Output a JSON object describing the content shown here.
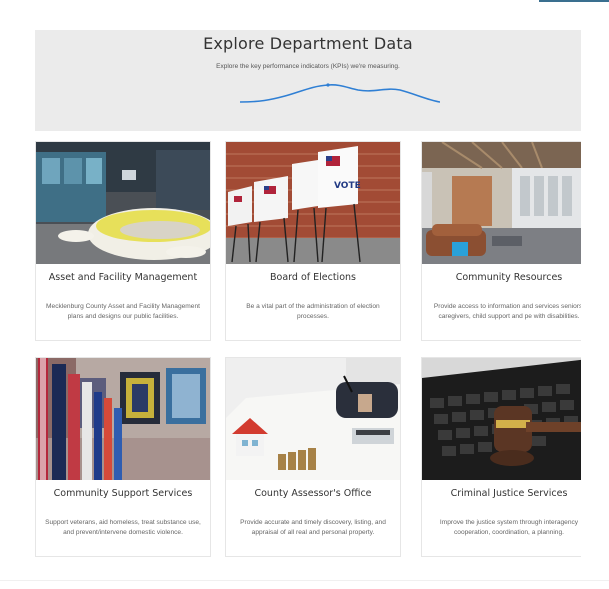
{
  "header": {
    "title": "Explore Department Data",
    "subtitle": "Explore the key performance indicators (KPIs) we're measuring."
  },
  "colors": {
    "hero_bg": "#ebebeb",
    "wave": "#2f7fd4",
    "accent": "#3a6f8f"
  },
  "cards": [
    {
      "title": "Asset and Facility Management",
      "description": "Mecklenburg County Asset and Facility Management plans and designs our public facilities.",
      "image": "modern-lobby-with-yellow-sofa"
    },
    {
      "title": "Board of Elections",
      "description": "Be a vital part of the administration of election processes.",
      "image": "voting-booths-with-flags"
    },
    {
      "title": "Community Resources",
      "description": "Provide access to information and services seniors, caregivers, child support and pe with disabilities.",
      "image": "library-interior-with-couches"
    },
    {
      "title": "Community Support Services",
      "description": "Support veterans, aid homeless, treat substance use, and prevent/intervene domestic violence.",
      "image": "flags-and-quilts-display"
    },
    {
      "title": "County Assessor's Office",
      "description": "Provide accurate and timely discovery, listing, and appraisal of all real and personal property.",
      "image": "house-model-calculator-coins"
    },
    {
      "title": "Criminal Justice Services",
      "description": "Improve the justice system through interagency cooperation, coordination, a planning.",
      "image": "gavel-on-keyboard"
    }
  ]
}
